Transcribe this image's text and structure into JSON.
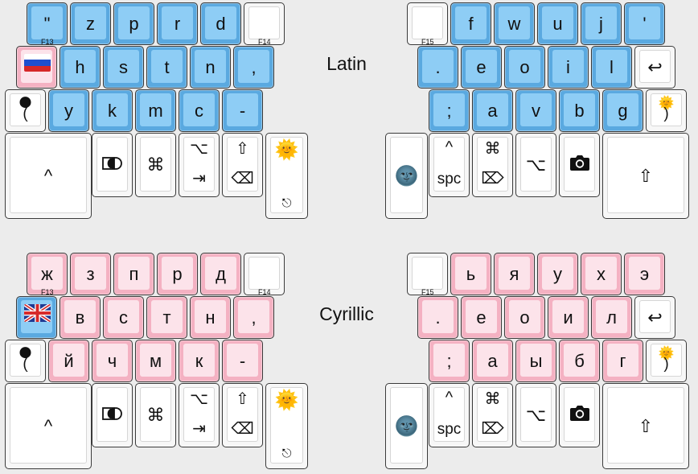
{
  "layers": [
    {
      "title": "Latin",
      "left_rows": {
        "row1": [
          "\"",
          "z",
          "p",
          "r",
          "d",
          ""
        ],
        "row2": [
          "h",
          "s",
          "t",
          "n",
          ","
        ],
        "row3": [
          "y",
          "k",
          "m",
          "c",
          "-"
        ],
        "thumbs": {
          "caret": "^",
          "cmd": "⌘",
          "opt_top": "⌥",
          "tab": "⇥",
          "shift_top": "⇧",
          "bksp": "⌫",
          "sun": "🌞",
          "reload": "⎋"
        }
      },
      "right_rows": {
        "row1": [
          "",
          "f",
          "w",
          "u",
          "j",
          "'"
        ],
        "row2": [
          ".",
          "e",
          "o",
          "i",
          "l",
          "↩"
        ],
        "row3": [
          ";",
          "a",
          "v",
          "b",
          "g"
        ],
        "thumbs": {
          "moon": "🌚",
          "spc_top": "^",
          "spc": "spc",
          "cmd": "⌘",
          "del": "⌦",
          "opt": "⌥",
          "camera": "📷",
          "shift": "⇧"
        }
      },
      "f_labels": {
        "f13": "F13",
        "f14": "F14",
        "f15": "F15"
      },
      "corner_left": {
        "icon": "🌑",
        "text": "("
      },
      "corner_right": {
        "icon": "🌞",
        "text": ")"
      },
      "flag": "ru"
    },
    {
      "title": "Cyrillic",
      "left_rows": {
        "row1": [
          "ж",
          "з",
          "п",
          "р",
          "д",
          ""
        ],
        "row2": [
          "в",
          "с",
          "т",
          "н",
          ","
        ],
        "row3": [
          "й",
          "ч",
          "м",
          "к",
          "-"
        ],
        "thumbs": {
          "caret": "^",
          "cmd": "⌘",
          "opt_top": "⌥",
          "tab": "⇥",
          "shift_top": "⇧",
          "bksp": "⌫",
          "sun": "🌞",
          "reload": "⎋"
        }
      },
      "right_rows": {
        "row1": [
          "",
          "ь",
          "я",
          "у",
          "х",
          "э"
        ],
        "row2": [
          ".",
          "е",
          "о",
          "и",
          "л",
          "↩"
        ],
        "row3": [
          ";",
          "а",
          "ы",
          "б",
          "г"
        ],
        "thumbs": {
          "moon": "🌚",
          "spc_top": "^",
          "spc": "spc",
          "cmd": "⌘",
          "del": "⌦",
          "opt": "⌥",
          "camera": "📷",
          "shift": "⇧"
        }
      },
      "f_labels": {
        "f13": "F13",
        "f14": "F14",
        "f15": "F15"
      },
      "corner_left": {
        "icon": "🌑",
        "text": "("
      },
      "corner_right": {
        "icon": "🌞",
        "text": ")"
      },
      "flag": "gb"
    }
  ],
  "colors": {
    "latin_accent": "#8ecdf5",
    "cyrillic_accent": "#fce3ea",
    "background": "#ececec"
  }
}
